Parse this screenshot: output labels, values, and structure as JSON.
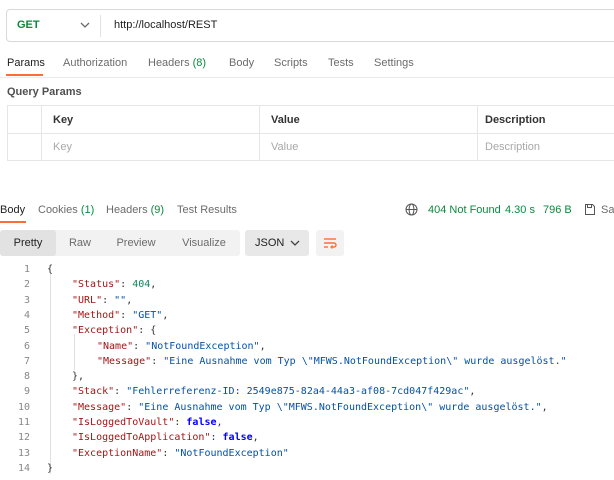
{
  "request": {
    "method": "GET",
    "url": "http://localhost/REST"
  },
  "request_tabs": {
    "params": "Params",
    "authorization": "Authorization",
    "headers": "Headers",
    "headers_count": "(8)",
    "body": "Body",
    "scripts": "Scripts",
    "tests": "Tests",
    "settings": "Settings",
    "active": "Params"
  },
  "query_params": {
    "title": "Query Params",
    "columns": [
      "Key",
      "Value",
      "Description"
    ],
    "placeholder_row": [
      "Key",
      "Value",
      "Description"
    ]
  },
  "response_tabs": {
    "body": "Body",
    "cookies": "Cookies",
    "cookies_count": "(1)",
    "headers": "Headers",
    "headers_count": "(9)",
    "test_results": "Test Results",
    "active": "Body"
  },
  "response_status": {
    "status": "404 Not Found",
    "time": "4.30 s",
    "size": "796 B",
    "save_partial": "Sa"
  },
  "format": {
    "pretty": "Pretty",
    "raw": "Raw",
    "preview": "Preview",
    "visualize": "Visualize",
    "active": "Pretty",
    "language": "JSON"
  },
  "colors": {
    "accent": "#ff6c37",
    "success": "#0b8a3e",
    "json_key": "#a31515",
    "json_string": "#0451a5",
    "json_number": "#098658",
    "json_boolean": "#0000ff"
  },
  "code_lines": [
    {
      "n": "1",
      "indent": 0,
      "parts": [
        [
          "punc",
          "{"
        ]
      ]
    },
    {
      "n": "2",
      "indent": 1,
      "parts": [
        [
          "key",
          "\"Status\""
        ],
        [
          "punc",
          ": "
        ],
        [
          "num",
          "404"
        ],
        [
          "punc",
          ","
        ]
      ]
    },
    {
      "n": "3",
      "indent": 1,
      "parts": [
        [
          "key",
          "\"URL\""
        ],
        [
          "punc",
          ": "
        ],
        [
          "str",
          "\"\""
        ],
        [
          "punc",
          ","
        ]
      ]
    },
    {
      "n": "4",
      "indent": 1,
      "parts": [
        [
          "key",
          "\"Method\""
        ],
        [
          "punc",
          ": "
        ],
        [
          "str",
          "\"GET\""
        ],
        [
          "punc",
          ","
        ]
      ]
    },
    {
      "n": "5",
      "indent": 1,
      "parts": [
        [
          "key",
          "\"Exception\""
        ],
        [
          "punc",
          ": {"
        ]
      ]
    },
    {
      "n": "6",
      "indent": 2,
      "parts": [
        [
          "key",
          "\"Name\""
        ],
        [
          "punc",
          ": "
        ],
        [
          "str",
          "\"NotFoundException\""
        ],
        [
          "punc",
          ","
        ]
      ]
    },
    {
      "n": "7",
      "indent": 2,
      "parts": [
        [
          "key",
          "\"Message\""
        ],
        [
          "punc",
          ": "
        ],
        [
          "str",
          "\"Eine Ausnahme vom Typ \\\"MFWS.NotFoundException\\\" wurde ausgelöst.\""
        ]
      ]
    },
    {
      "n": "8",
      "indent": 1,
      "parts": [
        [
          "punc",
          "},"
        ]
      ]
    },
    {
      "n": "9",
      "indent": 1,
      "parts": [
        [
          "key",
          "\"Stack\""
        ],
        [
          "punc",
          ": "
        ],
        [
          "str",
          "\"Fehlerreferenz-ID: 2549e875-82a4-44a3-af08-7cd047f429ac\""
        ],
        [
          "punc",
          ","
        ]
      ]
    },
    {
      "n": "10",
      "indent": 1,
      "parts": [
        [
          "key",
          "\"Message\""
        ],
        [
          "punc",
          ": "
        ],
        [
          "str",
          "\"Eine Ausnahme vom Typ \\\"MFWS.NotFoundException\\\" wurde ausgelöst.\""
        ],
        [
          "punc",
          ","
        ]
      ]
    },
    {
      "n": "11",
      "indent": 1,
      "parts": [
        [
          "key",
          "\"IsLoggedToVault\""
        ],
        [
          "punc",
          ": "
        ],
        [
          "bool",
          "false"
        ],
        [
          "punc",
          ","
        ]
      ]
    },
    {
      "n": "12",
      "indent": 1,
      "parts": [
        [
          "key",
          "\"IsLoggedToApplication\""
        ],
        [
          "punc",
          ": "
        ],
        [
          "bool",
          "false"
        ],
        [
          "punc",
          ","
        ]
      ]
    },
    {
      "n": "13",
      "indent": 1,
      "parts": [
        [
          "key",
          "\"ExceptionName\""
        ],
        [
          "punc",
          ": "
        ],
        [
          "str",
          "\"NotFoundException\""
        ]
      ]
    },
    {
      "n": "14",
      "indent": 0,
      "parts": [
        [
          "punc",
          "}"
        ]
      ]
    }
  ]
}
